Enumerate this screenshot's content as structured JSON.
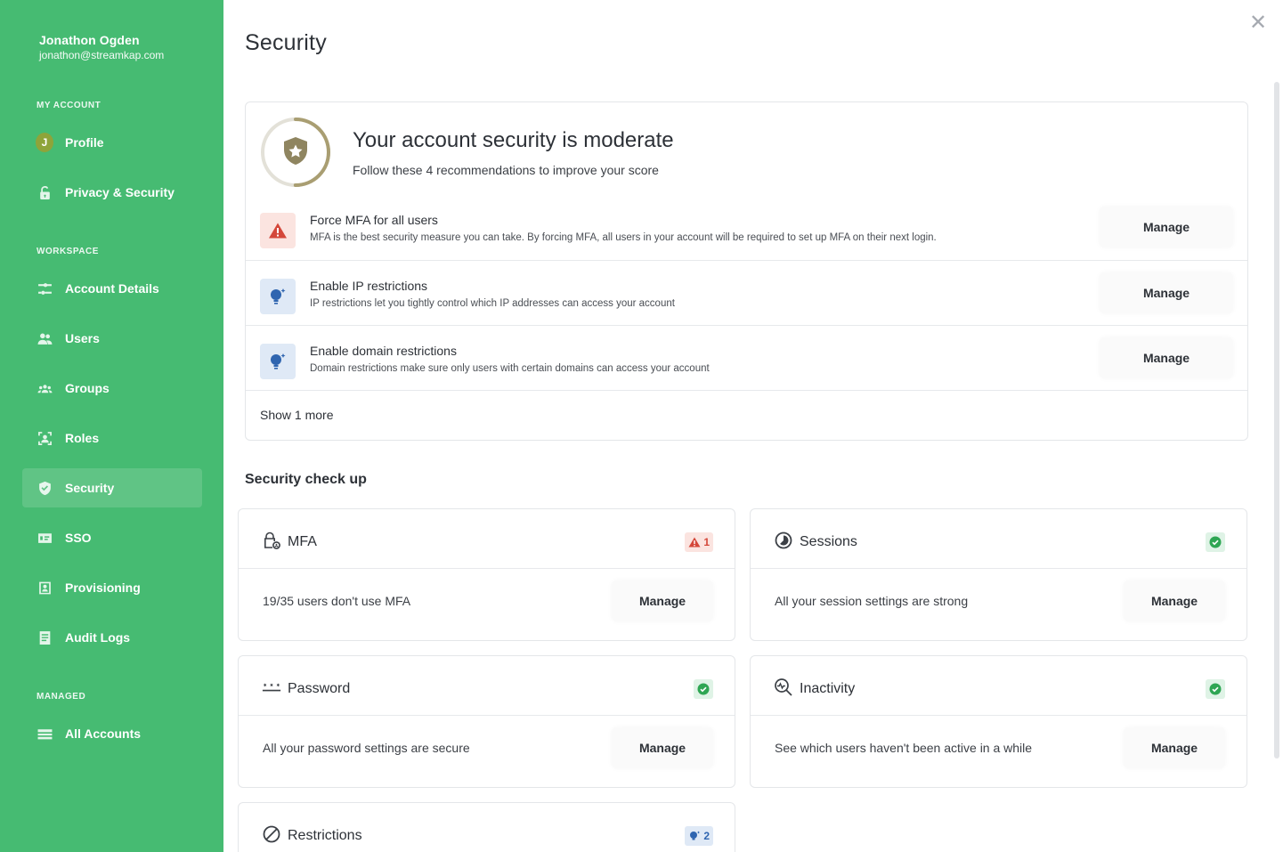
{
  "sidebar": {
    "user_name": "Jonathon Ogden",
    "user_email": "jonathon@streamkap.com",
    "avatar_letter": "J",
    "sections": {
      "my_account": "MY ACCOUNT",
      "workspace": "WORKSPACE",
      "managed": "MANAGED"
    },
    "items": [
      {
        "label": "Profile",
        "icon": "avatar"
      },
      {
        "label": "Privacy & Security",
        "icon": "lock-icon"
      },
      {
        "label": "Account Details",
        "icon": "sliders-icon"
      },
      {
        "label": "Users",
        "icon": "users-icon"
      },
      {
        "label": "Groups",
        "icon": "groups-icon"
      },
      {
        "label": "Roles",
        "icon": "roles-icon"
      },
      {
        "label": "Security",
        "icon": "shield-check-icon",
        "active": true
      },
      {
        "label": "SSO",
        "icon": "sso-icon"
      },
      {
        "label": "Provisioning",
        "icon": "provisioning-icon"
      },
      {
        "label": "Audit Logs",
        "icon": "document-icon"
      },
      {
        "label": "All Accounts",
        "icon": "accounts-icon"
      }
    ],
    "bg_color": "#46bb72"
  },
  "page": {
    "title": "Security",
    "close_icon": "close-icon"
  },
  "score": {
    "title": "Your account security is moderate",
    "subtitle": "Follow these 4 recommendations to improve your score",
    "level_fraction": 0.5,
    "ring_color": "#a99e72"
  },
  "recommendations": [
    {
      "title": "Force MFA for all users",
      "desc": "MFA is the best security measure you can take. By forcing MFA, all users in your account will be required to set up MFA on their next login.",
      "kind": "warning",
      "button": "Manage"
    },
    {
      "title": "Enable IP restrictions",
      "desc": "IP restrictions let you tightly control which IP addresses can access your account",
      "kind": "info",
      "button": "Manage"
    },
    {
      "title": "Enable domain restrictions",
      "desc": "Domain restrictions make sure only users with certain domains can access your account",
      "kind": "info",
      "button": "Manage"
    }
  ],
  "show_more": "Show 1 more",
  "checkup": {
    "title": "Security check up",
    "cards": [
      {
        "title": "MFA",
        "text": "19/35 users don't use MFA",
        "status": "warning",
        "count": "1",
        "button": "Manage"
      },
      {
        "title": "Sessions",
        "text": "All your session settings are strong",
        "status": "ok",
        "button": "Manage"
      },
      {
        "title": "Password",
        "text": "All your password settings are secure",
        "status": "ok",
        "button": "Manage"
      },
      {
        "title": "Inactivity",
        "text": "See which users haven't been active in a while",
        "status": "ok",
        "button": "Manage"
      },
      {
        "title": "Restrictions",
        "status": "info",
        "count": "2"
      }
    ]
  },
  "colors": {
    "warning": "#d4473a",
    "info": "#2f65b0",
    "ok": "#2ea653"
  }
}
